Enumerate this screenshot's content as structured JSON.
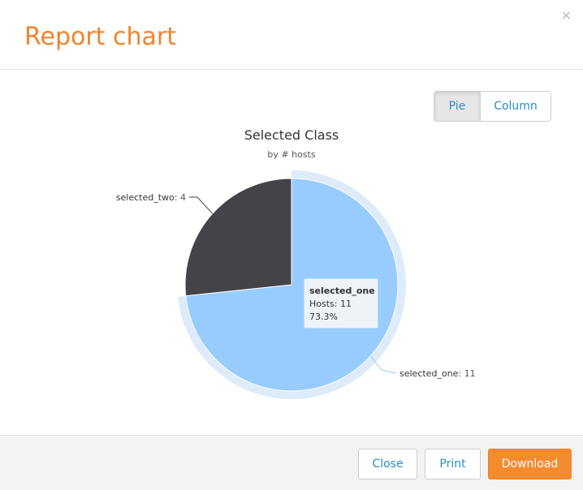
{
  "dialog": {
    "title": "Report chart",
    "close_glyph": "×"
  },
  "toggle": {
    "pie_label": "Pie",
    "column_label": "Column",
    "active": "Pie"
  },
  "footer": {
    "close_label": "Close",
    "print_label": "Print",
    "download_label": "Download"
  },
  "colors": {
    "accent": "#f0842c",
    "link": "#2b8dc2",
    "download_bg": "#f58b2f",
    "selected_one": "#99ccfe",
    "selected_one_halo": "#deebf8",
    "selected_two": "#434348"
  },
  "chart_data": {
    "type": "pie",
    "title": "Selected Class",
    "subtitle": "by # hosts",
    "slices": [
      {
        "name": "selected_one",
        "value": 11,
        "label_name": "selected_one",
        "label_value": ": 11",
        "color": "#99ccfe",
        "hovered": true
      },
      {
        "name": "selected_two",
        "value": 4,
        "label_name": "selected_two",
        "label_value": ": 4",
        "color": "#434348",
        "hovered": false
      }
    ],
    "tooltip": {
      "title": "selected_one",
      "line1": "Hosts: 11",
      "line2": "73.3%"
    }
  }
}
